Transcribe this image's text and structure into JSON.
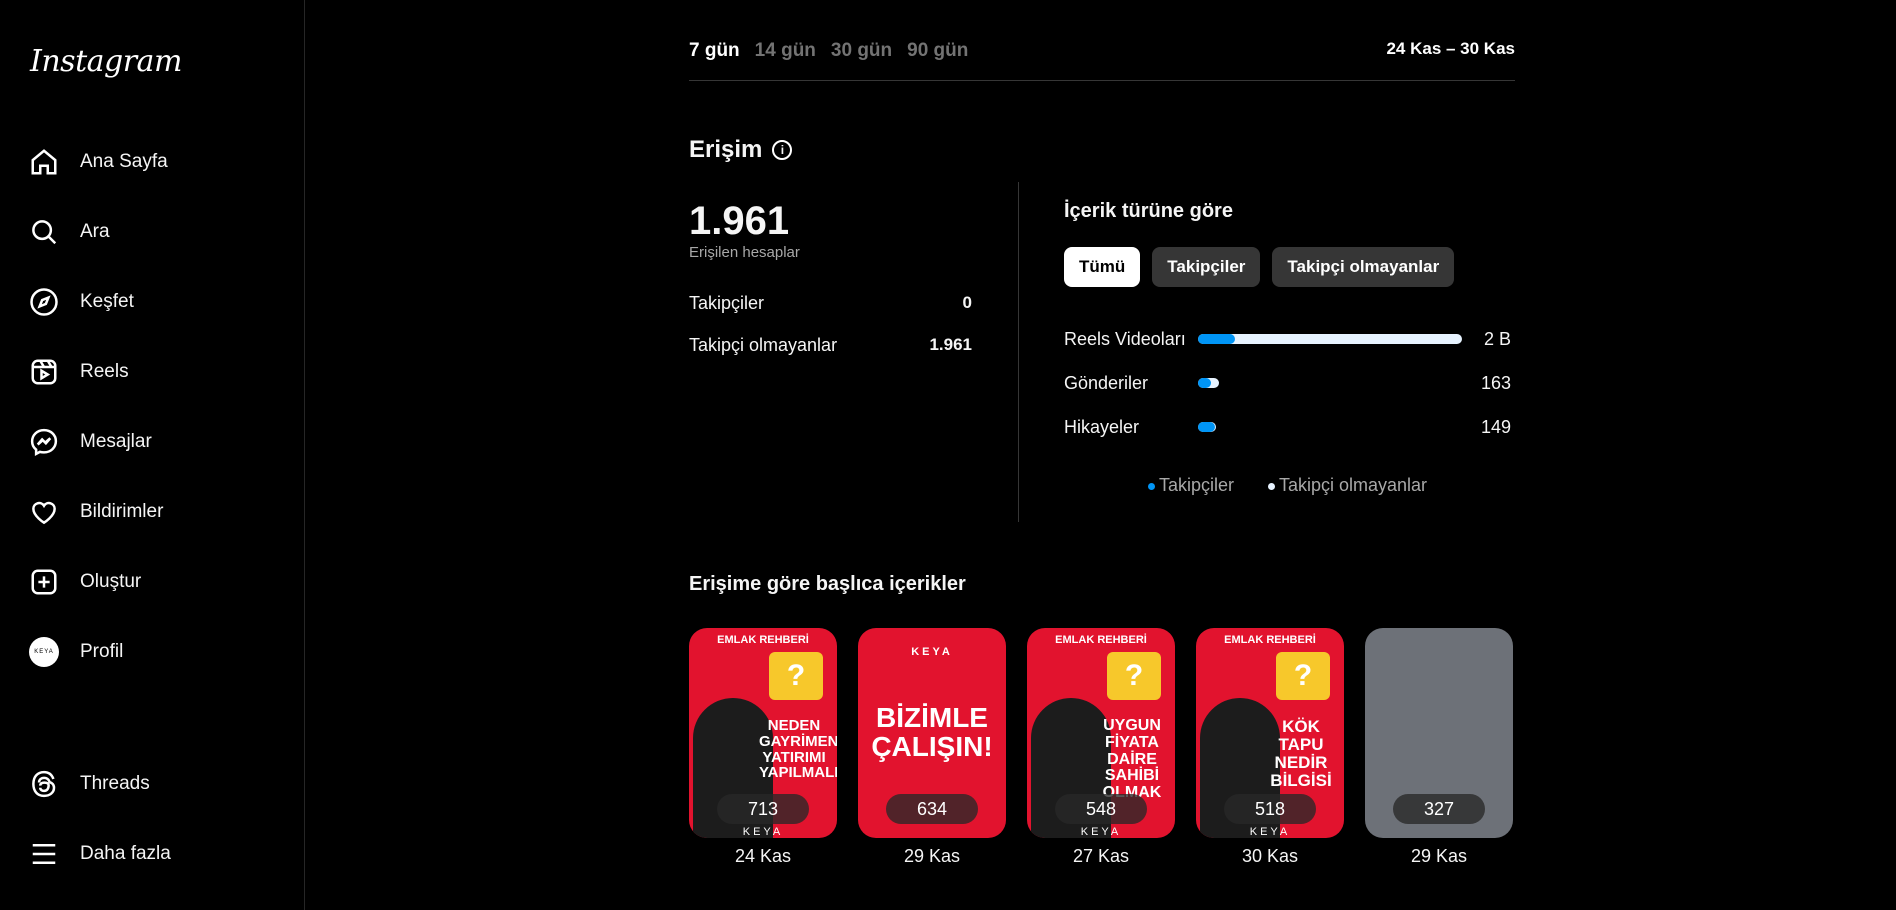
{
  "sidebar": {
    "logo": "Instagram",
    "items": [
      {
        "label": "Ana Sayfa",
        "icon": "home-icon"
      },
      {
        "label": "Ara",
        "icon": "search-icon"
      },
      {
        "label": "Keşfet",
        "icon": "compass-icon"
      },
      {
        "label": "Reels",
        "icon": "reels-icon"
      },
      {
        "label": "Mesajlar",
        "icon": "messenger-icon"
      },
      {
        "label": "Bildirimler",
        "icon": "heart-icon"
      },
      {
        "label": "Oluştur",
        "icon": "plus-square-icon"
      },
      {
        "label": "Profil",
        "icon": "avatar",
        "avatar_text": "KEYA"
      }
    ],
    "bottom_items": [
      {
        "label": "Threads",
        "icon": "threads-icon"
      },
      {
        "label": "Daha fazla",
        "icon": "menu-icon"
      }
    ]
  },
  "periods": [
    "7 gün",
    "14 gün",
    "30 gün",
    "90 gün"
  ],
  "active_period": "7 gün",
  "date_range": "24 Kas – 30 Kas",
  "reach": {
    "title": "Erişim",
    "total": "1.961",
    "total_label": "Erişilen hesaplar",
    "rows": [
      {
        "label": "Takipçiler",
        "value": "0"
      },
      {
        "label": "Takipçi olmayanlar",
        "value": "1.961"
      }
    ]
  },
  "content_type": {
    "title": "İçerik türüne göre",
    "chips": [
      "Tümü",
      "Takipçiler",
      "Takipçi olmayanlar"
    ],
    "bars": [
      {
        "label": "Reels Videoları",
        "value": "2 B",
        "length_frac": 1.0,
        "follower_frac": 0.14
      },
      {
        "label": "Gönderiler",
        "value": "163",
        "length_frac": 0.08,
        "follower_frac": 0.6
      },
      {
        "label": "Hikayeler",
        "value": "149",
        "length_frac": 0.07,
        "follower_frac": 0.95
      }
    ],
    "legend": [
      {
        "label": "Takipçiler",
        "color": "#0095f6"
      },
      {
        "label": "Takipçi olmayanlar",
        "color": "#e7f3ff"
      }
    ]
  },
  "top_content": {
    "title": "Erişime göre başlıca içerikler",
    "items": [
      {
        "count": "713",
        "date": "24 Kas",
        "brand": "EMLAK REHBERİ",
        "headline": "NEDEN GAYRİMENKUL YATIRIMI YAPILMALI?",
        "footer": "KEYA"
      },
      {
        "count": "634",
        "date": "29 Kas",
        "brand": "KEYA",
        "headline": "BİZİMLE ÇALIŞIN!",
        "footer": ""
      },
      {
        "count": "548",
        "date": "27 Kas",
        "brand": "EMLAK REHBERİ",
        "headline": "UYGUN FİYATA DAİRE SAHİBİ OLMAK",
        "footer": "KEYA"
      },
      {
        "count": "518",
        "date": "30 Kas",
        "brand": "EMLAK REHBERİ",
        "headline": "KÖK TAPU NEDİR BİLGİSİ",
        "footer": "KEYA"
      },
      {
        "count": "327",
        "date": "29 Kas",
        "brand": "",
        "headline": "",
        "footer": ""
      }
    ]
  }
}
